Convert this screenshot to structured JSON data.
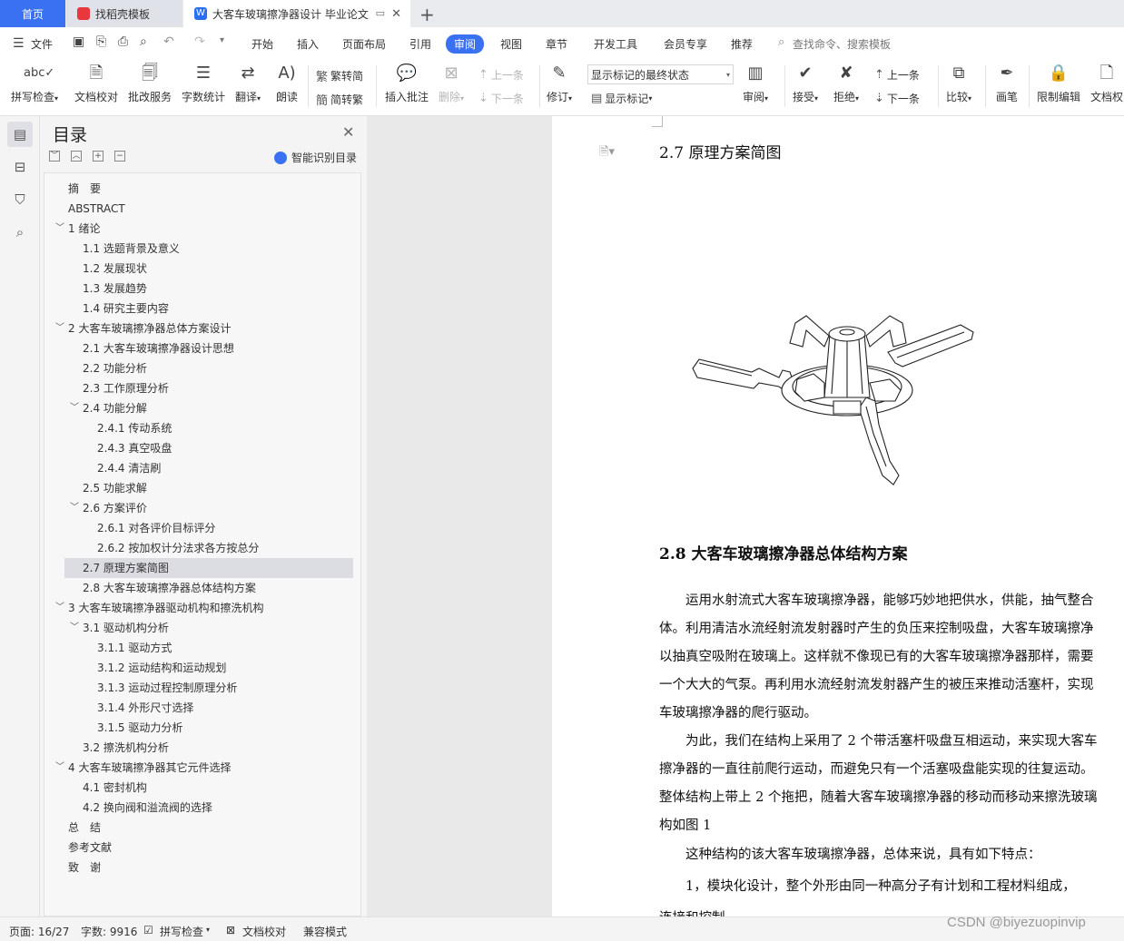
{
  "tabs": {
    "home": "首页",
    "templates": "找稻壳模板",
    "document": "大客车玻璃擦净器设计 毕业论文",
    "add": "+"
  },
  "menu": {
    "file": "文件",
    "items": [
      "开始",
      "插入",
      "页面布局",
      "引用",
      "审阅",
      "视图",
      "章节",
      "开发工具",
      "会员专享",
      "推荐"
    ],
    "active": "审阅",
    "search": "查找命令、搜索模板"
  },
  "ribbon": {
    "spellcheck": "拼写检查",
    "doc_proof": "文档校对",
    "annotation_service": "批改服务",
    "word_count": "字数统计",
    "translate": "翻译",
    "read_aloud": "朗读",
    "trad_to_simp": "繁转简",
    "simp_to_trad": "简转繁",
    "insert_comment": "插入批注",
    "delete": "删除",
    "prev_comment": "上一条",
    "next_comment": "下一条",
    "track_changes": "修订",
    "markup_select": "显示标记的最终状态",
    "show_markup": "显示标记",
    "review": "审阅",
    "accept": "接受",
    "reject": "拒绝",
    "prev_change": "上一条",
    "next_change": "下一条",
    "compare": "比较",
    "pen": "画笔",
    "restrict_edit": "限制编辑",
    "doc_permission": "文档权"
  },
  "toc": {
    "title": "目录",
    "smart": "智能识别目录",
    "items": [
      {
        "text": "摘　要",
        "level": 0,
        "caret": ""
      },
      {
        "text": "ABSTRACT",
        "level": 0,
        "caret": ""
      },
      {
        "text": "1  绪论",
        "level": 0,
        "caret": "﹀"
      },
      {
        "text": "1.1 选题背景及意义",
        "level": 1,
        "caret": ""
      },
      {
        "text": "1.2 发展现状",
        "level": 1,
        "caret": ""
      },
      {
        "text": "1.3 发展趋势",
        "level": 1,
        "caret": ""
      },
      {
        "text": "1.4 研究主要内容",
        "level": 1,
        "caret": ""
      },
      {
        "text": "2  大客车玻璃擦净器总体方案设计",
        "level": 0,
        "caret": "﹀"
      },
      {
        "text": "2.1  大客车玻璃擦净器设计思想",
        "level": 1,
        "caret": ""
      },
      {
        "text": "2.2 功能分析",
        "level": 1,
        "caret": ""
      },
      {
        "text": "2.3 工作原理分析",
        "level": 1,
        "caret": ""
      },
      {
        "text": "2.4 功能分解",
        "level": 1,
        "caret": "﹀"
      },
      {
        "text": "2.4.1 传动系统",
        "level": 2,
        "caret": ""
      },
      {
        "text": "2.4.3 真空吸盘",
        "level": 2,
        "caret": ""
      },
      {
        "text": "2.4.4  清洁刷",
        "level": 2,
        "caret": ""
      },
      {
        "text": "2.5 功能求解",
        "level": 1,
        "caret": ""
      },
      {
        "text": "2.6 方案评价",
        "level": 1,
        "caret": "﹀"
      },
      {
        "text": "2.6.1 对各评价目标评分",
        "level": 2,
        "caret": ""
      },
      {
        "text": "2.6.2 按加权计分法求各方按总分",
        "level": 2,
        "caret": ""
      },
      {
        "text": "2.7 原理方案简图",
        "level": 1,
        "caret": "",
        "selected": true
      },
      {
        "text": "2.8  大客车玻璃擦净器总体结构方案",
        "level": 1,
        "caret": ""
      },
      {
        "text": "3  大客车玻璃擦净器驱动机构和擦洗机构",
        "level": 0,
        "caret": "﹀"
      },
      {
        "text": "3.1  驱动机构分析",
        "level": 1,
        "caret": "﹀"
      },
      {
        "text": "3.1.1  驱动方式",
        "level": 2,
        "caret": ""
      },
      {
        "text": "3.1.2 运动结构和运动规划",
        "level": 2,
        "caret": ""
      },
      {
        "text": "3.1.3 运动过程控制原理分析",
        "level": 2,
        "caret": ""
      },
      {
        "text": "3.1.4 外形尺寸选择",
        "level": 2,
        "caret": ""
      },
      {
        "text": "3.1.5 驱动力分析",
        "level": 2,
        "caret": ""
      },
      {
        "text": "3.2 擦洗机构分析",
        "level": 1,
        "caret": ""
      },
      {
        "text": "4  大客车玻璃擦净器其它元件选择",
        "level": 0,
        "caret": "﹀"
      },
      {
        "text": "4.1 密封机构",
        "level": 1,
        "caret": ""
      },
      {
        "text": "4.2 换向阀和溢流阀的选择",
        "level": 1,
        "caret": ""
      },
      {
        "text": "总　结",
        "level": 0,
        "caret": ""
      },
      {
        "text": "参考文献",
        "level": 0,
        "caret": ""
      },
      {
        "text": "致　谢",
        "level": 0,
        "caret": ""
      }
    ]
  },
  "doc": {
    "sec27": "2.7 原理方案简图",
    "sec28": "2.8  大客车玻璃擦净器总体结构方案",
    "lines": [
      "　　运用水射流式大客车玻璃擦净器，能够巧妙地把供水，供能，抽气整合",
      "体。利用清洁水流经射流发射器时产生的负压来控制吸盘，大客车玻璃擦净",
      "以抽真空吸附在玻璃上。这样就不像现已有的大客车玻璃擦净器那样，需要",
      "一个大大的气泵。再利用水流经射流发射器产生的被压来推动活塞杆，实现",
      "车玻璃擦净器的爬行驱动。",
      "　　为此，我们在结构上采用了 2 个带活塞杆吸盘互相运动，来实现大客车",
      "擦净器的一直往前爬行运动，而避免只有一个活塞吸盘能实现的往复运动。",
      "整体结构上带上 2 个拖把，随着大客车玻璃擦净器的移动而移动来擦洗玻璃",
      "构如图 1",
      "　　这种结构的该大客车玻璃擦净器，总体来说，具有如下特点：",
      "　　1，模块化设计，整个外形由同一种高分子有计划和工程材料组成，",
      "连接和控制"
    ]
  },
  "status": {
    "page": "页面: 16/27",
    "words": "字数: 9916",
    "spellcheck": "拼写检查",
    "proof": "文档校对",
    "compat": "兼容模式"
  },
  "watermark": "CSDN @biyezuopinvip",
  "colors": {
    "accent": "#3a71f2",
    "panel": "#f4f4f5",
    "selected_row": "#dcdde3"
  }
}
